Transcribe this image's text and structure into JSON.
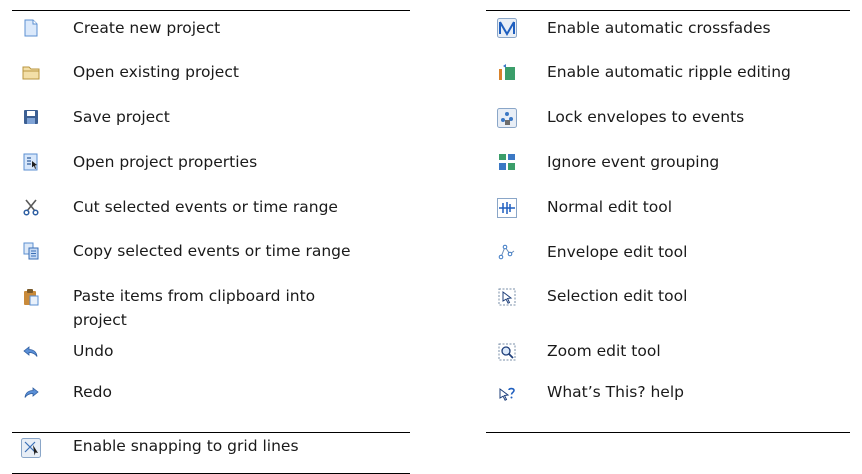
{
  "left_table": {
    "rows": [
      {
        "icon": "new-project-icon",
        "label": "Create new project"
      },
      {
        "icon": "open-folder-icon",
        "label": "Open existing project"
      },
      {
        "icon": "save-disk-icon",
        "label": "Save project"
      },
      {
        "icon": "project-properties-icon",
        "label": "Open project properties"
      },
      {
        "icon": "scissors-cut-icon",
        "label": "Cut selected events or time range"
      },
      {
        "icon": "copy-icon",
        "label": "Copy selected events or time range"
      },
      {
        "icon": "paste-clipboard-icon",
        "label": "Paste items from clipboard into",
        "label_line2": "project"
      },
      {
        "icon": "undo-icon",
        "label": "Undo"
      },
      {
        "icon": "redo-icon",
        "label": "Redo"
      },
      {
        "icon": "snap-grid-icon",
        "label": "Enable snapping to grid lines"
      }
    ]
  },
  "right_table": {
    "rows": [
      {
        "icon": "auto-crossfade-icon",
        "label": "Enable automatic crossfades"
      },
      {
        "icon": "ripple-edit-icon",
        "label": "Enable automatic ripple editing"
      },
      {
        "icon": "lock-envelopes-icon",
        "label": "Lock envelopes to events"
      },
      {
        "icon": "ignore-grouping-icon",
        "label": "Ignore event grouping"
      },
      {
        "icon": "normal-edit-tool-icon",
        "label": "Normal edit tool"
      },
      {
        "icon": "envelope-edit-tool-icon",
        "label": "Envelope edit tool"
      },
      {
        "icon": "selection-edit-tool-icon",
        "label": "Selection edit tool"
      },
      {
        "icon": "zoom-edit-tool-icon",
        "label": "Zoom edit tool"
      },
      {
        "icon": "whats-this-help-icon",
        "label": "What’s This? help"
      }
    ]
  },
  "colors": {
    "rule": "#000000",
    "icon_blue": "#3b78c4",
    "icon_folder": "#e5c98a"
  }
}
